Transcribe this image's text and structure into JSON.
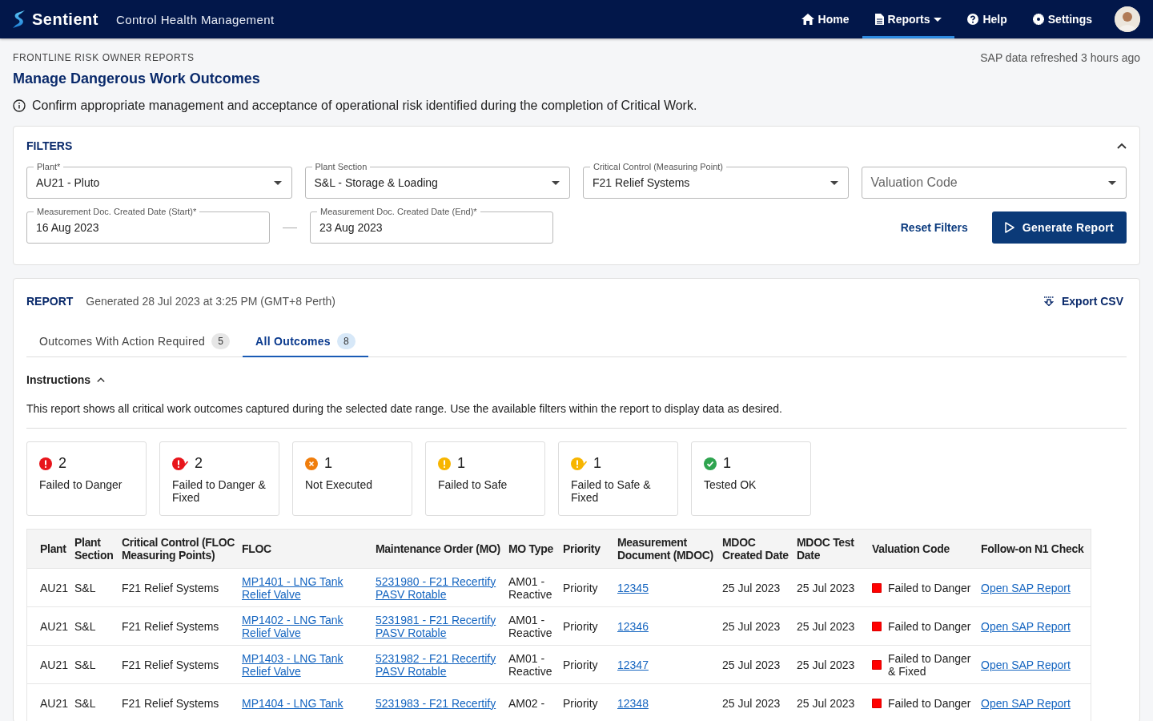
{
  "topbar": {
    "brand": "Sentient",
    "app_title": "Control Health Management",
    "nav": [
      {
        "label": "Home",
        "selected": false,
        "dropdown": false
      },
      {
        "label": "Reports",
        "selected": true,
        "dropdown": true
      },
      {
        "label": "Help",
        "selected": false,
        "dropdown": false
      },
      {
        "label": "Settings",
        "selected": false,
        "dropdown": false
      }
    ]
  },
  "header": {
    "eyebrow": "FRONTLINE RISK OWNER REPORTS",
    "refresh_note": "SAP data refreshed 3 hours ago",
    "title": "Manage Dangerous Work Outcomes",
    "info": "Confirm appropriate management and acceptance of operational risk identified during the completion of Critical Work."
  },
  "filters": {
    "title": "FILTERS",
    "expanded": true,
    "fields": [
      {
        "label": "Plant*",
        "value": "AU21 - Pluto",
        "kind": "select"
      },
      {
        "label": "Plant Section",
        "value": "S&L - Storage & Loading",
        "kind": "select"
      },
      {
        "label": "Critical Control (Measuring Point)",
        "value": "F21 Relief Systems",
        "kind": "select"
      },
      {
        "placeholder": "Valuation Code",
        "kind": "select"
      }
    ],
    "dates": [
      {
        "label": "Measurement Doc. Created Date (Start)*",
        "value": "16 Aug 2023"
      },
      {
        "label": "Measurement Doc. Created Date (End)*",
        "value": "23 Aug 2023"
      }
    ],
    "reset": "Reset Filters",
    "generate": "Generate Report"
  },
  "report": {
    "title": "REPORT",
    "generated": "Generated 28 Jul 2023 at 3:25 PM (GMT+8 Perth)",
    "export": "Export CSV",
    "tabs": [
      {
        "label": "Outcomes With Action Required",
        "count": "5",
        "selected": false
      },
      {
        "label": "All Outcomes",
        "count": "8",
        "selected": true
      }
    ],
    "instructions": {
      "label": "Instructions",
      "expanded": true,
      "text": "This report shows all critical work outcomes captured during the selected date range. Use the available filters within the report to display data as desired."
    },
    "summary": [
      {
        "kind": "danger",
        "count": "2",
        "label": "Failed to Danger"
      },
      {
        "kind": "danger-fixed",
        "count": "2",
        "label": "Failed to Danger & Fixed"
      },
      {
        "kind": "not-executed",
        "count": "1",
        "label": "Not Executed"
      },
      {
        "kind": "safe",
        "count": "1",
        "label": "Failed to Safe"
      },
      {
        "kind": "safe-fixed",
        "count": "1",
        "label": "Failed to Safe & Fixed"
      },
      {
        "kind": "ok",
        "count": "1",
        "label": "Tested OK"
      }
    ],
    "table": {
      "columns": [
        "Plant",
        "Plant Section",
        "Critical Control (FLOC Measuring Points)",
        "FLOC",
        "Maintenance Order (MO)",
        "MO Type",
        "Priority",
        "Measurement Document (MDOC)",
        "MDOC Created Date",
        "MDOC Test Date",
        "Valuation Code",
        "Follow-on N1 Check"
      ],
      "rows": [
        {
          "plant": "AU21",
          "section": "S&L",
          "control": "F21 Relief Systems",
          "floc": "MP1401 - LNG Tank Relief Valve",
          "mo": "5231980 - F21 Recertify PASV Rotable",
          "mo_type": "AM01 - Reactive",
          "priority": "Priority",
          "mdoc": "12345",
          "created": "25 Jul 2023",
          "tested": "25 Jul 2023",
          "valuation": {
            "label": "Failed to Danger",
            "color": "#ff0000"
          },
          "follow": "Open SAP Report"
        },
        {
          "plant": "AU21",
          "section": "S&L",
          "control": "F21 Relief Systems",
          "floc": "MP1402 - LNG Tank Relief Valve",
          "mo": "5231981 - F21 Recertify PASV Rotable",
          "mo_type": "AM01 - Reactive",
          "priority": "Priority",
          "mdoc": "12346",
          "created": "25 Jul 2023",
          "tested": "25 Jul 2023",
          "valuation": {
            "label": "Failed to Danger",
            "color": "#ff0000"
          },
          "follow": "Open SAP Report"
        },
        {
          "plant": "AU21",
          "section": "S&L",
          "control": "F21 Relief Systems",
          "floc": "MP1403 - LNG Tank Relief Valve",
          "mo": "5231982 - F21 Recertify PASV Rotable",
          "mo_type": "AM01 - Reactive",
          "priority": "Priority",
          "mdoc": "12347",
          "created": "25 Jul 2023",
          "tested": "25 Jul 2023",
          "valuation": {
            "label": "Failed to Danger & Fixed",
            "color": "#ff0000"
          },
          "follow": "Open SAP Report"
        },
        {
          "plant": "AU21",
          "section": "S&L",
          "control": "F21 Relief Systems",
          "floc": "MP1404 - LNG Tank",
          "mo": "5231983 - F21 Recertify",
          "mo_type": "AM02 -",
          "priority": "Priority",
          "mdoc": "12348",
          "created": "25 Jul 2023",
          "tested": "25 Jul 2023",
          "valuation": {
            "label": "Failed to Danger",
            "color": "#ff0000"
          },
          "follow": "Open SAP Report"
        }
      ]
    }
  }
}
